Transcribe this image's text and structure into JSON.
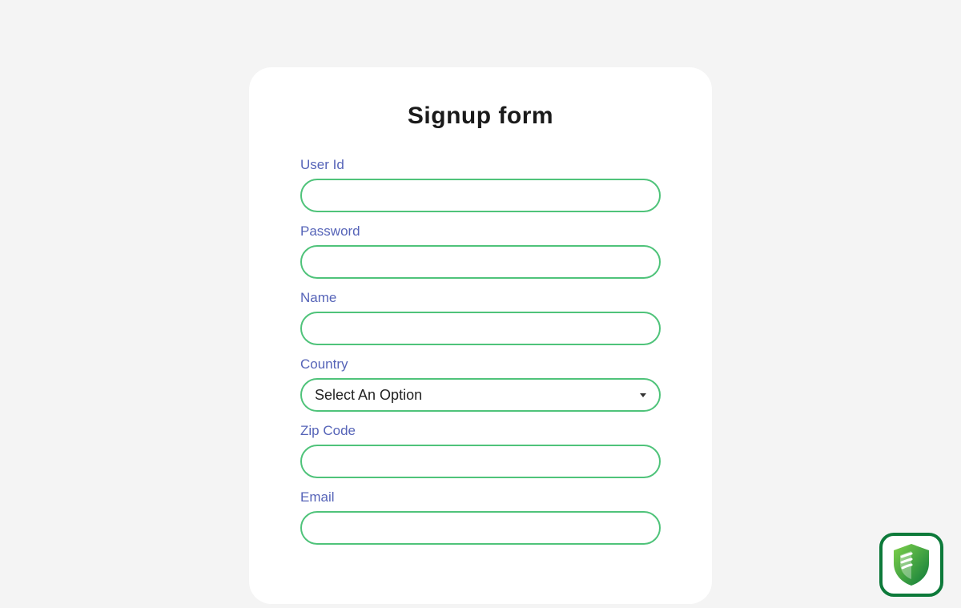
{
  "form": {
    "title": "Signup form",
    "userId": {
      "label": "User Id"
    },
    "password": {
      "label": "Password"
    },
    "name": {
      "label": "Name"
    },
    "country": {
      "label": "Country",
      "selected": "Select An Option"
    },
    "zip": {
      "label": "Zip Code"
    },
    "email": {
      "label": "Email"
    }
  }
}
